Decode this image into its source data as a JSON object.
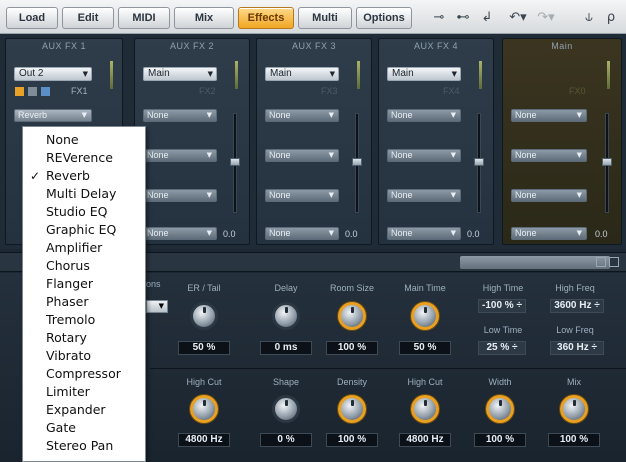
{
  "toolbar": {
    "buttons": [
      {
        "label": "Load",
        "active": false
      },
      {
        "label": "Edit",
        "active": false
      },
      {
        "label": "MIDI",
        "active": false
      },
      {
        "label": "Mix",
        "active": false
      },
      {
        "label": "Effects",
        "active": true
      },
      {
        "label": "Multi",
        "active": false
      },
      {
        "label": "Options",
        "active": false
      }
    ],
    "icons": [
      "route-split-icon",
      "route-merge-icon",
      "route-return-icon",
      "undo-icon",
      "redo-icon",
      "tuning-fork-icon",
      "search-icon"
    ]
  },
  "channels": [
    {
      "title": "AUX FX 1",
      "output": "Out 2",
      "fx_label": "FX1",
      "slot": "Reverb",
      "gain": ""
    },
    {
      "title": "AUX FX 2",
      "output": "Main",
      "fx_label": "FX2",
      "slot": "None",
      "gain": "0.0"
    },
    {
      "title": "AUX FX 3",
      "output": "Main",
      "fx_label": "FX3",
      "slot": "None",
      "gain": "0.0"
    },
    {
      "title": "AUX FX 4",
      "output": "Main",
      "fx_label": "FX4",
      "slot": "None",
      "gain": "0.0"
    },
    {
      "title": "Main",
      "output": "",
      "fx_label": "FX0",
      "slot": "None",
      "gain": "0.0"
    }
  ],
  "params": {
    "row1": [
      {
        "label": "ER / Tail",
        "value": "50 %",
        "gold": false
      },
      {
        "label": "Delay",
        "value": "0 ms",
        "gold": false
      },
      {
        "label": "Room Size",
        "value": "100 %",
        "gold": true
      },
      {
        "label": "Main Time",
        "value": "50 %",
        "gold": true
      }
    ],
    "row2": [
      {
        "label": "High Cut",
        "value": "4800 Hz",
        "gold": true
      },
      {
        "label": "Shape",
        "value": "0 %",
        "gold": false
      },
      {
        "label": "Density",
        "value": "100 %",
        "gold": true
      },
      {
        "label": "High Cut",
        "value": "4800 Hz",
        "gold": true
      },
      {
        "label": "Width",
        "value": "100 %",
        "gold": true
      },
      {
        "label": "Mix",
        "value": "100 %",
        "gold": true
      }
    ],
    "steppers": [
      {
        "label": "High Time",
        "value": "-100 % ÷"
      },
      {
        "label": "High Freq",
        "value": "3600 Hz ÷"
      },
      {
        "label": "Low Time",
        "value": "25 % ÷"
      },
      {
        "label": "Low Freq",
        "value": "360 Hz ÷"
      }
    ],
    "partial_label": "ons"
  },
  "menu": {
    "items": [
      "None",
      "REVerence",
      "Reverb",
      "Multi Delay",
      "Studio EQ",
      "Graphic EQ",
      "Amplifier",
      "Chorus",
      "Flanger",
      "Phaser",
      "Tremolo",
      "Rotary",
      "Vibrato",
      "Compressor",
      "Limiter",
      "Expander",
      "Gate",
      "Stereo Pan"
    ],
    "checked_index": 2,
    "check_glyph": "✓"
  },
  "colors": {
    "accent": "#f0a623",
    "knob_ring": "#e9a021",
    "panel": "#1c2733"
  }
}
